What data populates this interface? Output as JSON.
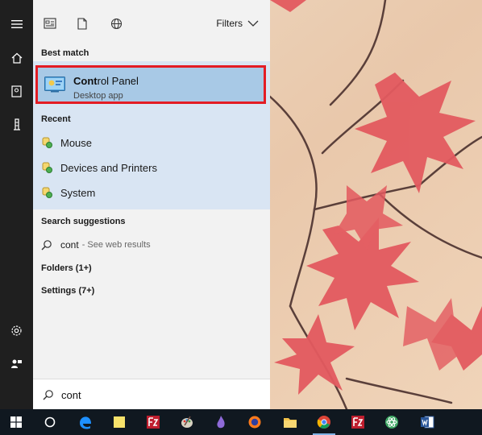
{
  "filters_label": "Filters",
  "best_match": {
    "heading": "Best match",
    "title_bold": "Cont",
    "title_rest": "rol Panel",
    "subtitle": "Desktop app"
  },
  "recent": {
    "heading": "Recent",
    "items": [
      "Mouse",
      "Devices and Printers",
      "System"
    ]
  },
  "suggestions": {
    "heading": "Search suggestions",
    "query": "cont",
    "hint": "- See web results"
  },
  "categories": [
    "Folders (1+)",
    "Settings (7+)"
  ],
  "search": {
    "value": "cont"
  },
  "colors": {
    "highlight_border": "#e31c24",
    "selected_bg": "#a8c9e6",
    "rail_bg": "#1f1f1f",
    "taskbar_bg": "#101820"
  },
  "rail_icons": [
    "hamburger-icon",
    "home-icon",
    "notebook-icon",
    "tower-icon",
    "settings-gear-icon",
    "user-feedback-icon"
  ],
  "taskbar_icons": [
    "windows-start-icon",
    "cortana-icon",
    "edge-icon",
    "sticky-notes-icon",
    "filezilla-icon",
    "paint-icon",
    "app-icon",
    "firefox-icon",
    "file-explorer-icon",
    "chrome-icon",
    "filezilla-icon",
    "atom-icon",
    "word-icon"
  ]
}
